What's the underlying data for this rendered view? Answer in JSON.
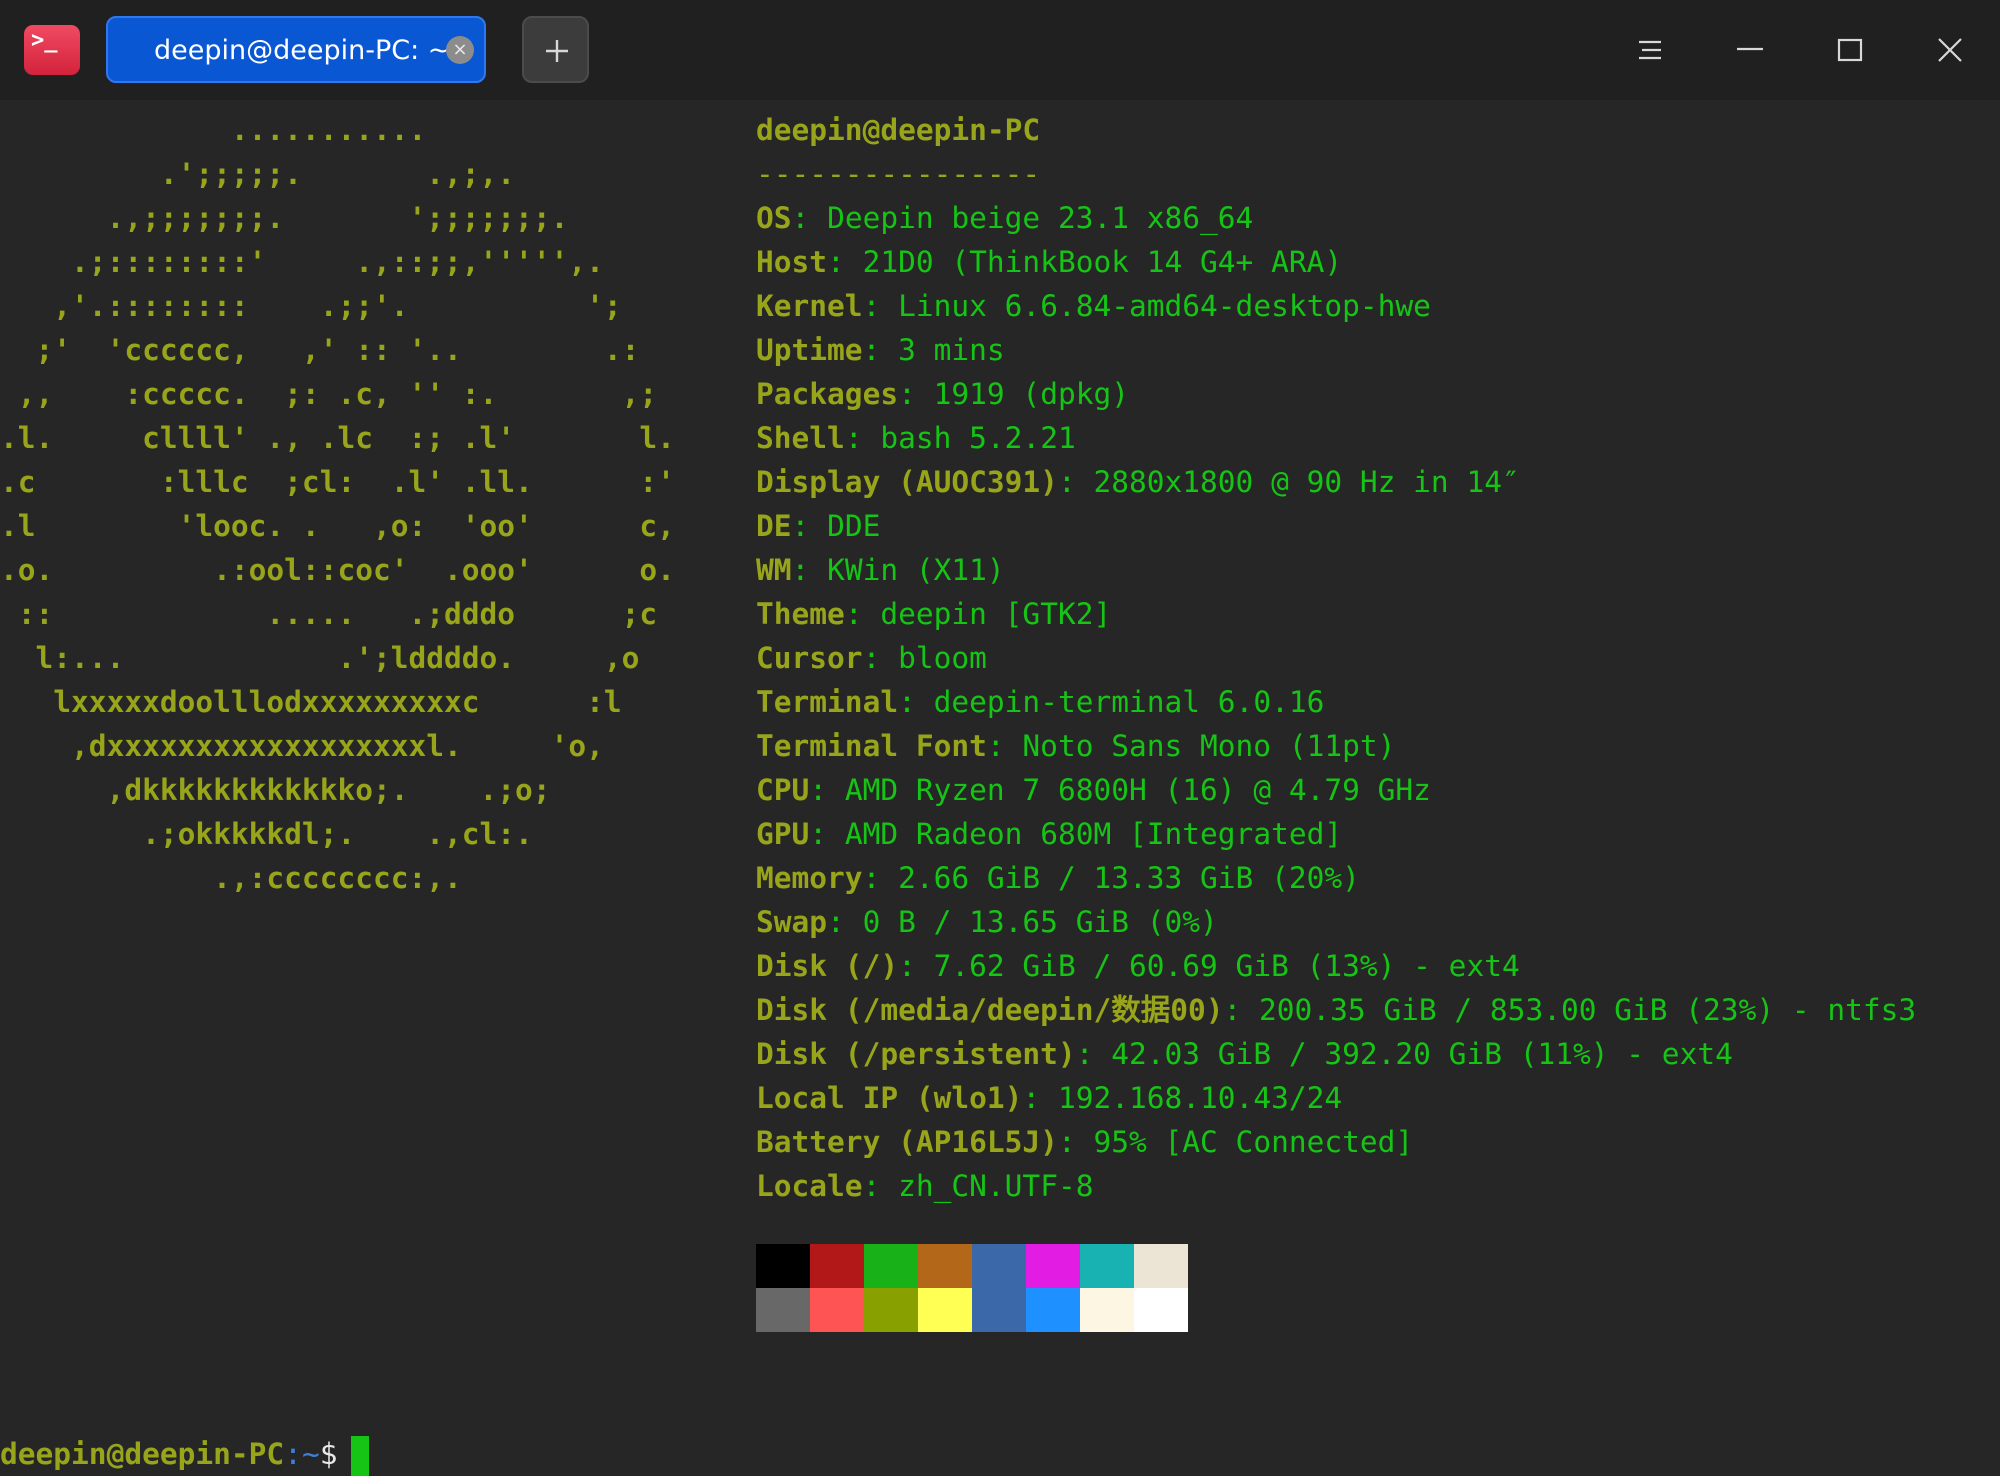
{
  "titlebar": {
    "app_icon_text": ">_",
    "tab_title": "deepin@deepin-PC: ~",
    "tab_close_glyph": "×",
    "new_tab_icon": "plus-icon",
    "menu_icon": "menu-icon",
    "minimize_icon": "minimize-icon",
    "maximize_icon": "maximize-icon",
    "close_icon": "close-icon"
  },
  "logo_lines": [
    "             ...........",
    "         .';;;;;.       .,;,.",
    "      .,;;;;;;;.       ';;;;;;;.",
    "    .;::::::::'     .,::;;,''''',.",
    "   ,'.::::::::    .;;'.          ';",
    "  ;'  'cccccc,   ,' :: '..        .:",
    " ,,    :ccccc.  ;: .c, '' :.       ,;",
    ".l.     cllll' ., .lc  :; .l'       l.",
    ".c       :lllc  ;cl:  .l' .ll.      :'",
    ".l        'looc. .   ,o:  'oo'      c,",
    ".o.         .:ool::coc'  .ooo'      o.",
    " ::            .....   .;dddo      ;c",
    "  l:...            .';lddddo.     ,o",
    "   lxxxxxdoolllodxxxxxxxxxc      :l",
    "    ,dxxxxxxxxxxxxxxxxxxl.     'o,",
    "      ,dkkkkkkkkkkkko;.    .;o;",
    "        .;okkkkkdl;.    .,cl:.",
    "            .,:cccccccc:,."
  ],
  "sysinfo": {
    "header": "deepin@deepin-PC",
    "separator": "----------------",
    "rows": [
      {
        "key": "OS",
        "value": "Deepin beige 23.1 x86_64"
      },
      {
        "key": "Host",
        "value": "21D0 (ThinkBook 14 G4+ ARA)"
      },
      {
        "key": "Kernel",
        "value": "Linux 6.6.84-amd64-desktop-hwe"
      },
      {
        "key": "Uptime",
        "value": "3 mins"
      },
      {
        "key": "Packages",
        "value": "1919 (dpkg)"
      },
      {
        "key": "Shell",
        "value": "bash 5.2.21"
      },
      {
        "key": "Display (AUOC391)",
        "value": "2880x1800 @ 90 Hz in 14″"
      },
      {
        "key": "DE",
        "value": "DDE"
      },
      {
        "key": "WM",
        "value": "KWin (X11)"
      },
      {
        "key": "Theme",
        "value": "deepin [GTK2]"
      },
      {
        "key": "Cursor",
        "value": "bloom"
      },
      {
        "key": "Terminal",
        "value": "deepin-terminal 6.0.16"
      },
      {
        "key": "Terminal Font",
        "value": "Noto Sans Mono (11pt)"
      },
      {
        "key": "CPU",
        "value": "AMD Ryzen 7 6800H (16) @ 4.79 GHz"
      },
      {
        "key": "GPU",
        "value": "AMD Radeon 680M [Integrated]"
      },
      {
        "key": "Memory",
        "value": "2.66 GiB / 13.33 GiB (20%)"
      },
      {
        "key": "Swap",
        "value": "0 B / 13.65 GiB (0%)"
      },
      {
        "key": "Disk (/)",
        "value": "7.62 GiB / 60.69 GiB (13%) - ext4"
      },
      {
        "key": "Disk (/media/deepin/数据00)",
        "value": "200.35 GiB / 853.00 GiB (23%) - ntfs3"
      },
      {
        "key": "Disk (/persistent)",
        "value": "42.03 GiB / 392.20 GiB (11%) - ext4"
      },
      {
        "key": "Local IP (wlo1)",
        "value": "192.168.10.43/24"
      },
      {
        "key": "Battery (AP16L5J)",
        "value": "95% [AC Connected]"
      },
      {
        "key": "Locale",
        "value": "zh_CN.UTF-8"
      }
    ]
  },
  "palette": {
    "normal": [
      "#000000",
      "#b21818",
      "#18b218",
      "#b26818",
      "#3a68a8",
      "#e21ce2",
      "#18b2b2",
      "#ece4d4"
    ],
    "bright": [
      "#686868",
      "#ff5454",
      "#88a000",
      "#ffff54",
      "#3a68a8",
      "#1e90ff",
      "#fdf6e3",
      "#ffffff"
    ]
  },
  "prompt": {
    "user_host": "deepin@deepin-PC",
    "colon": ":",
    "path": "~",
    "symbol": "$"
  }
}
